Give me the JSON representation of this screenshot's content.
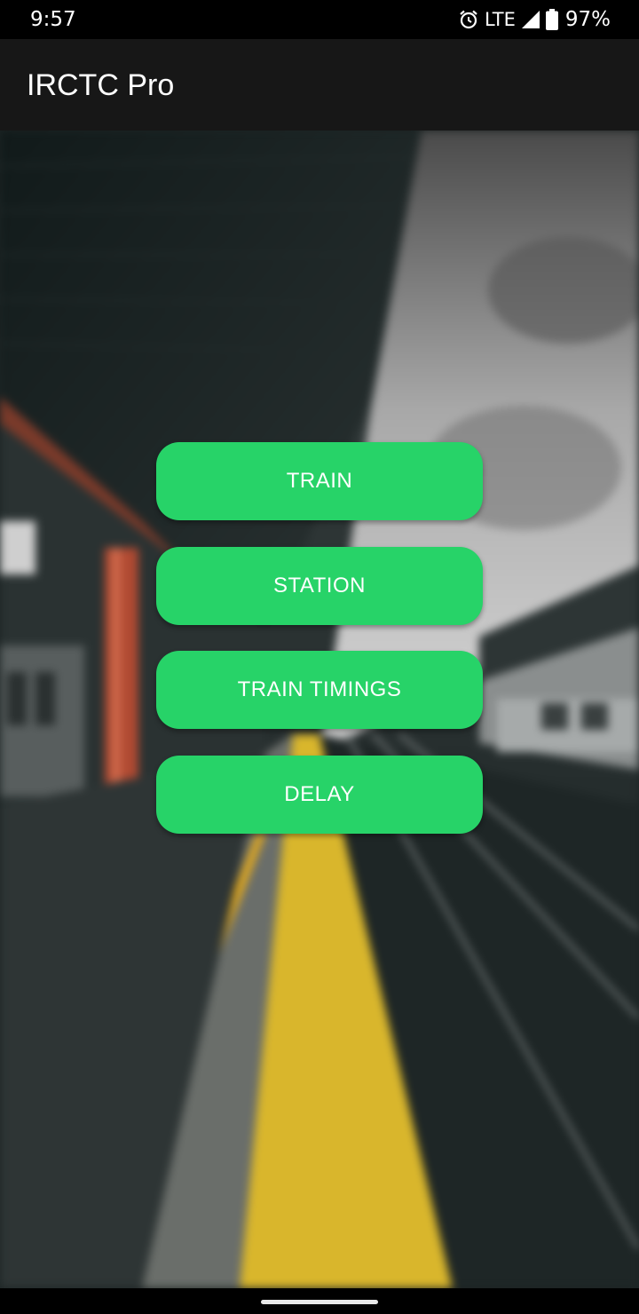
{
  "status_bar": {
    "time": "9:57",
    "network": "LTE",
    "battery": "97%",
    "icons": [
      "alarm-icon",
      "signal-icon",
      "battery-icon"
    ]
  },
  "app_bar": {
    "title": "IRCTC Pro"
  },
  "menu": {
    "buttons": [
      {
        "label": "TRAIN"
      },
      {
        "label": "STATION"
      },
      {
        "label": "TRAIN TIMINGS"
      },
      {
        "label": "DELAY"
      }
    ]
  },
  "colors": {
    "accent": "#27d368",
    "app_bar": "#171717",
    "status_bar": "#000000",
    "platform_stripe": "#d9b62c"
  }
}
